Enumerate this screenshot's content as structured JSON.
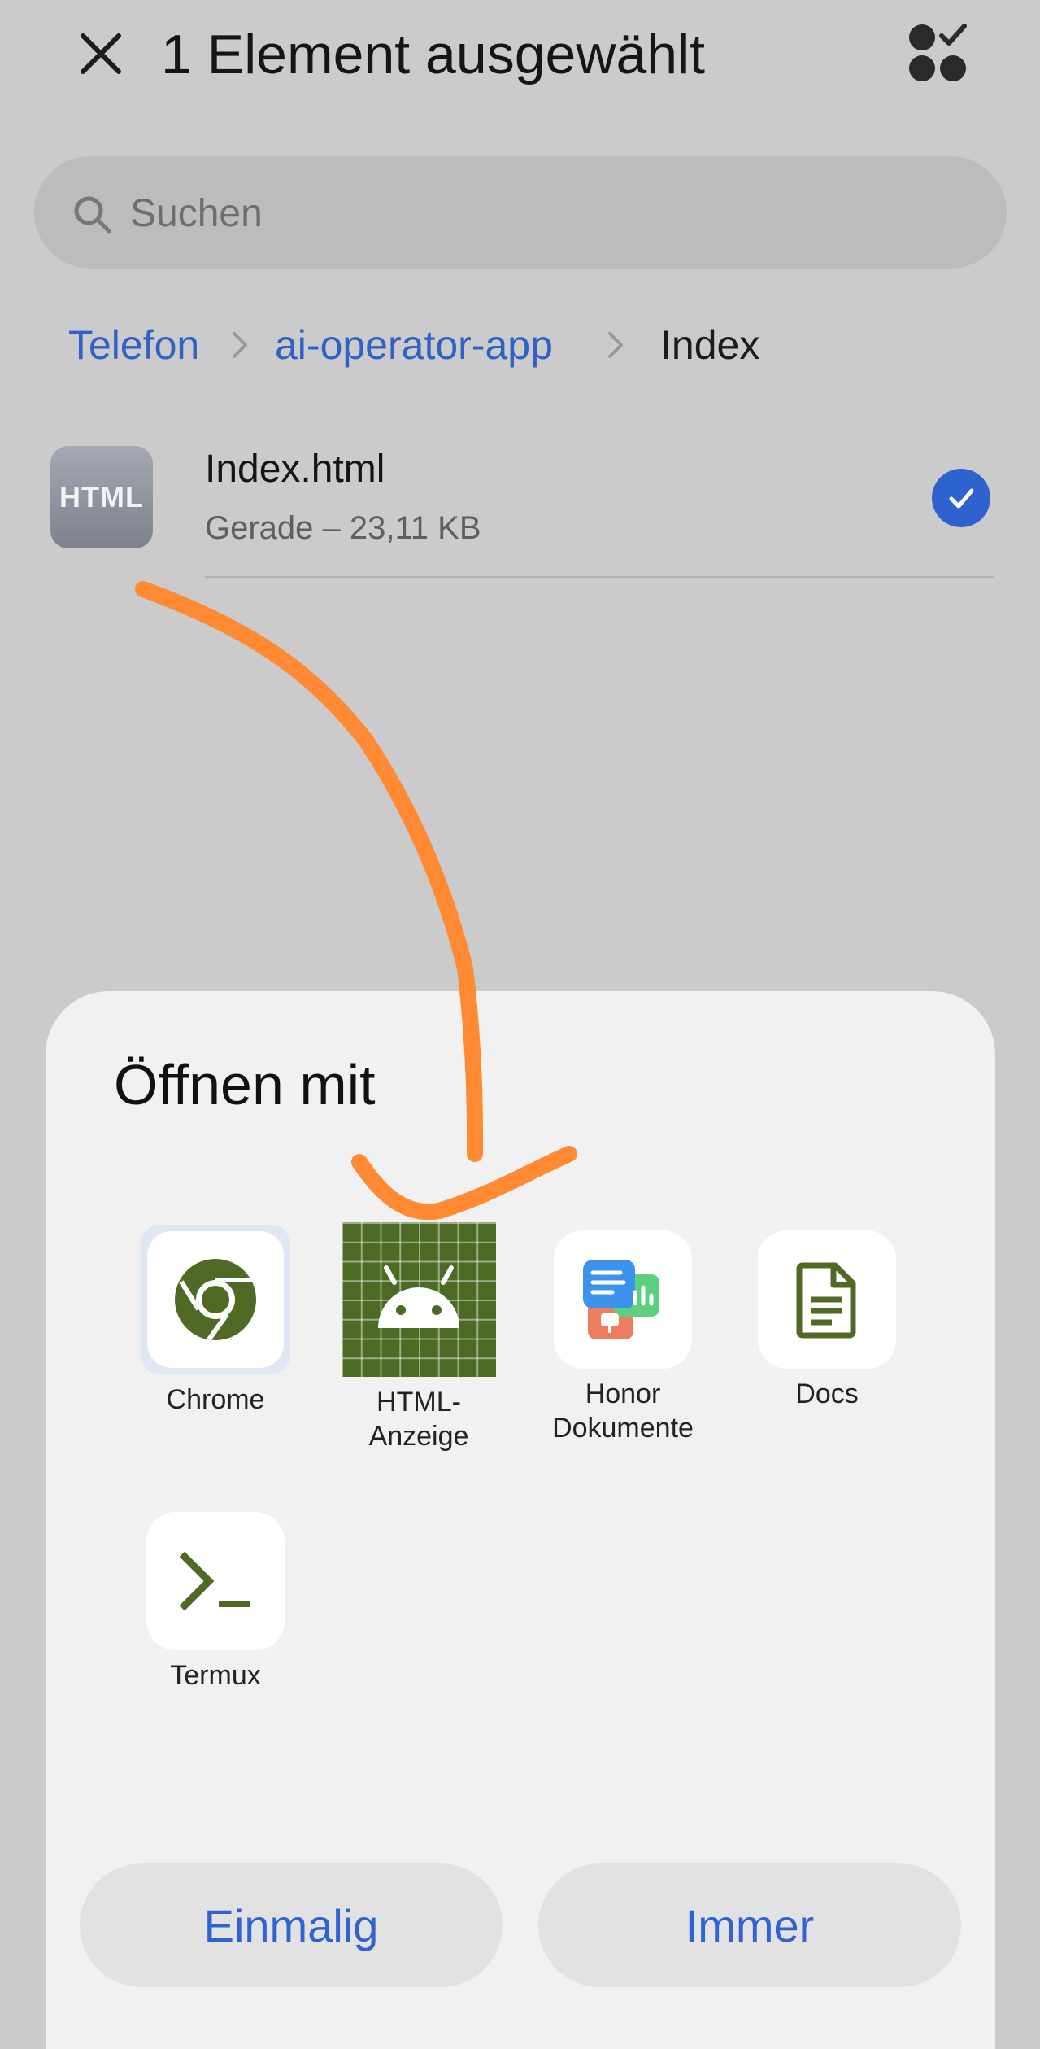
{
  "header": {
    "title": "1 Element ausgewählt"
  },
  "search": {
    "placeholder": "Suchen"
  },
  "breadcrumb": {
    "items": [
      "Telefon",
      "ai-operator-app",
      "Index"
    ]
  },
  "file": {
    "thumb_label": "HTML",
    "name": "Index.html",
    "meta": "Gerade – 23,11 KB",
    "selected": true
  },
  "open_with": {
    "title": "Öffnen mit",
    "apps": [
      {
        "label": "Chrome",
        "icon": "chrome-icon"
      },
      {
        "label": "HTML-\nAnzeige",
        "icon": "android-icon"
      },
      {
        "label": "Honor\nDokumente",
        "icon": "honor-documents-icon"
      },
      {
        "label": "Docs",
        "icon": "document-icon"
      },
      {
        "label": "Termux",
        "icon": "terminal-icon"
      }
    ],
    "buttons": {
      "once": "Einmalig",
      "always": "Immer"
    }
  },
  "colors": {
    "accent": "#2d62cf",
    "app_green": "#4c6a23",
    "annotation": "#ff8a33"
  }
}
